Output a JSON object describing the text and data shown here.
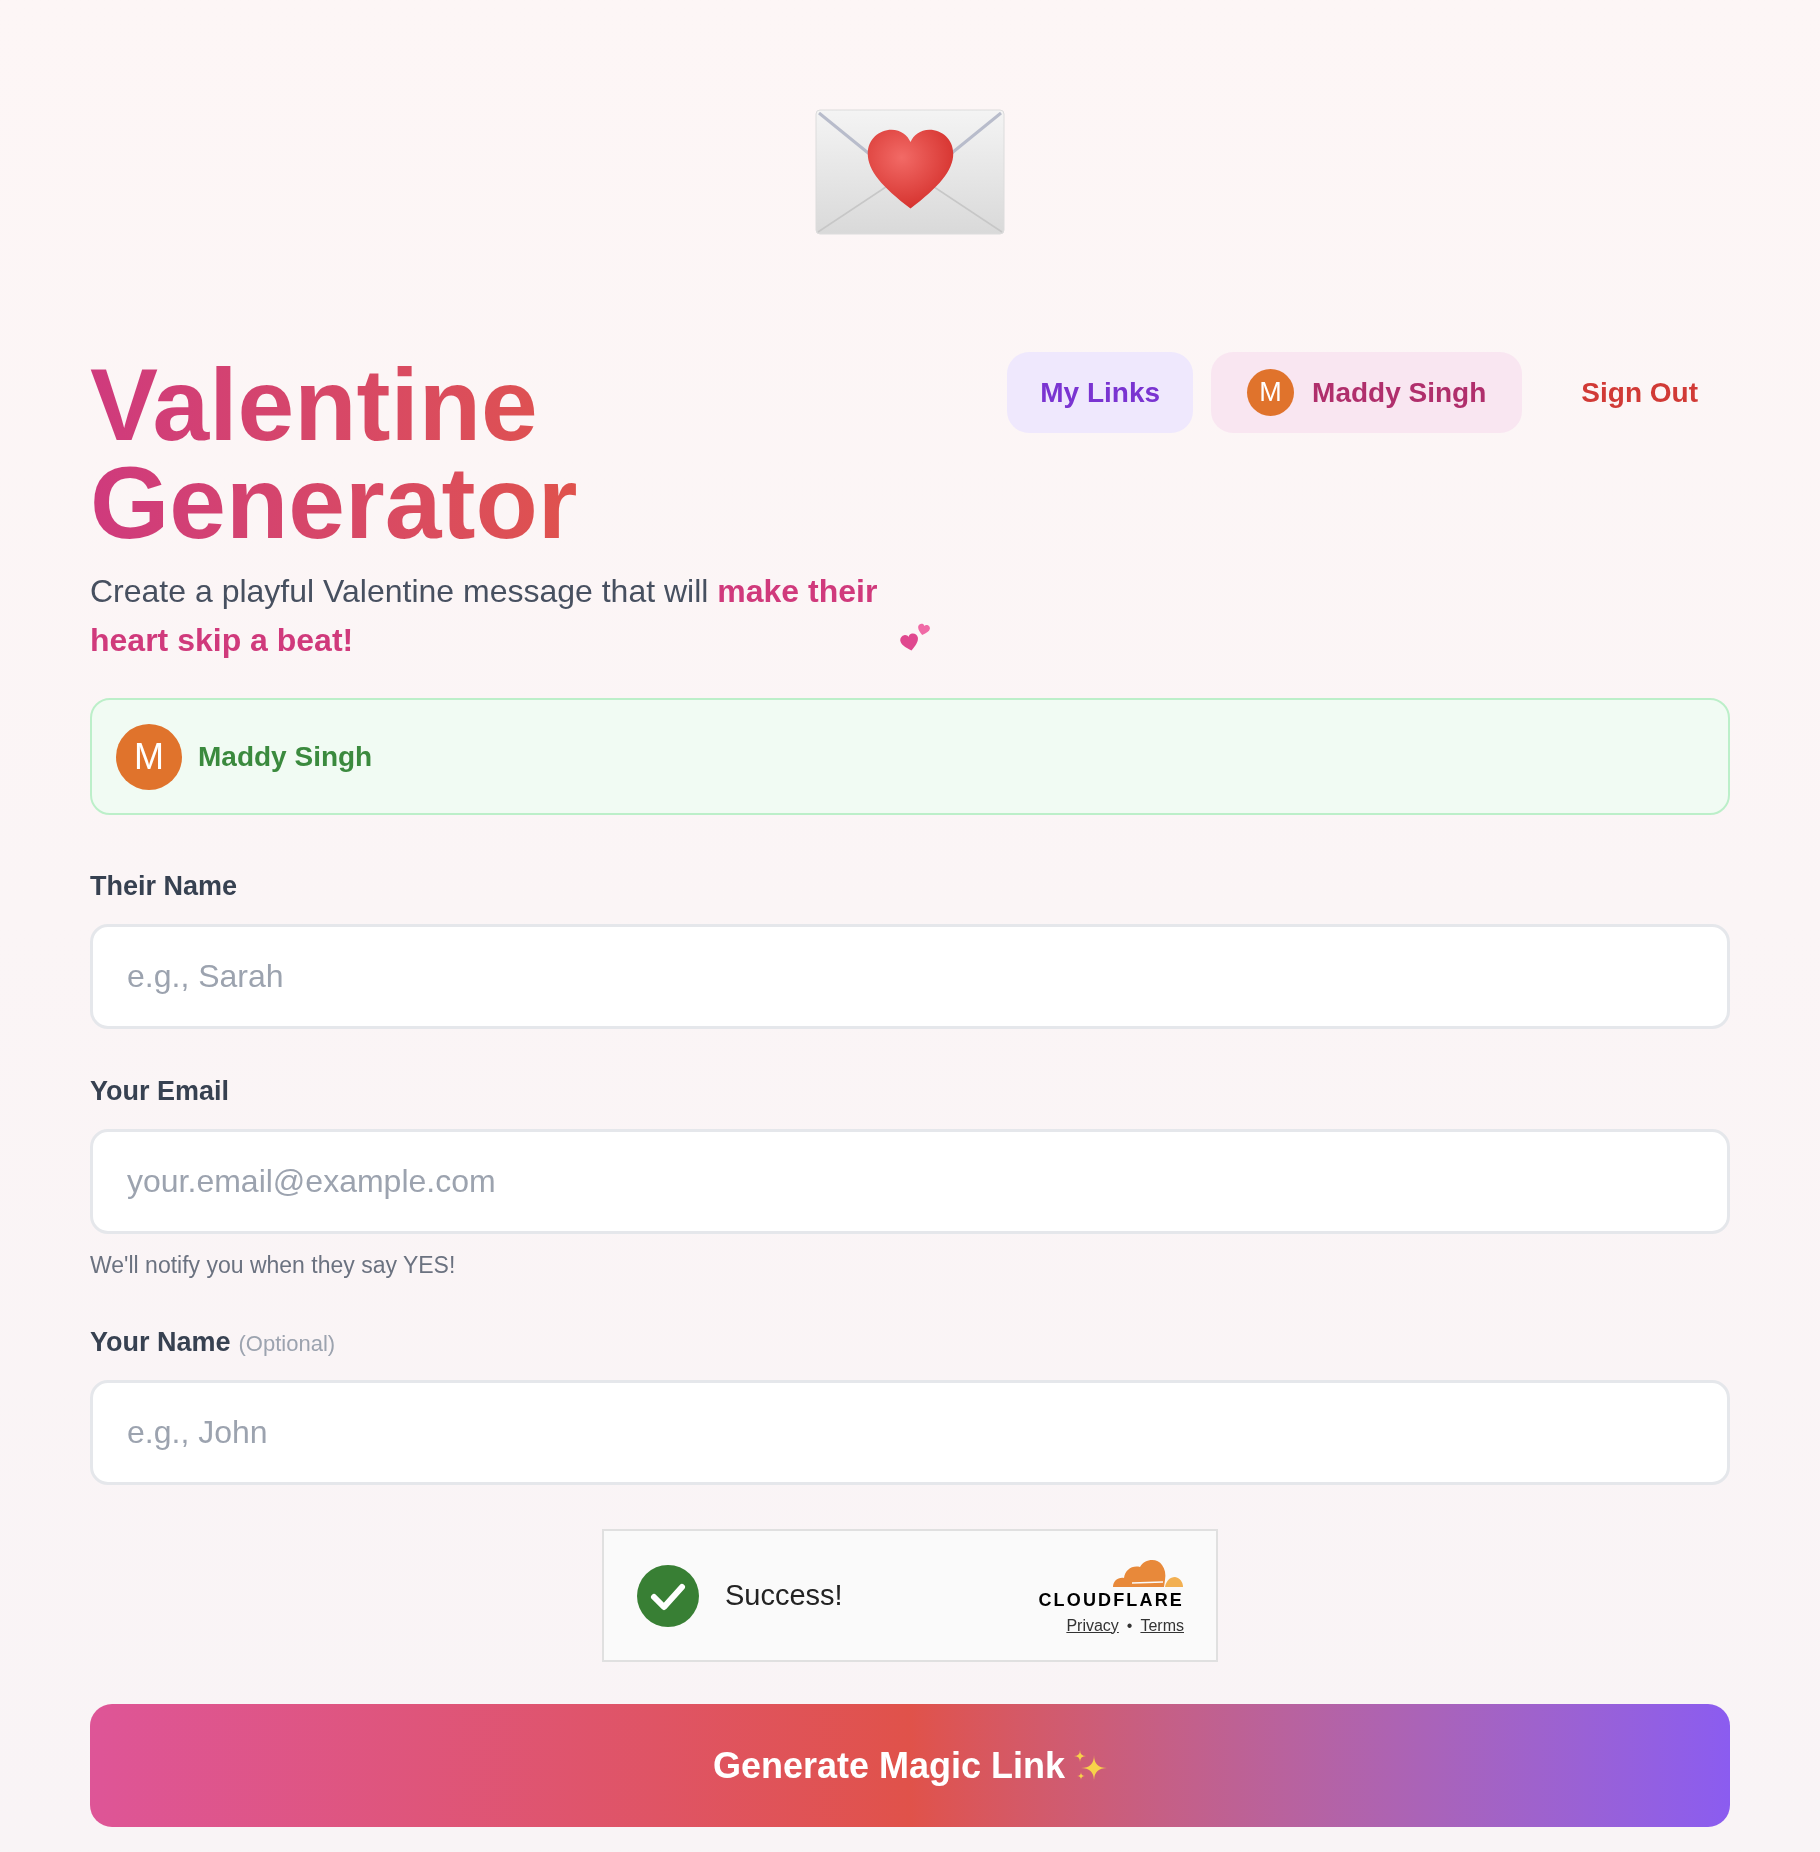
{
  "title": "Valentine Generator",
  "subtitle": "Create a playful Valentine message that will **make their heart skip a beat!**",
  "nav": [
    {
      "kind": "links",
      "label": "My Links"
    },
    {
      "kind": "profile",
      "initial": "M",
      "label": "Maddy Singh"
    },
    {
      "kind": "signout",
      "label": "Sign Out"
    }
  ],
  "signed_in_user": {
    "initial": "M",
    "name": "Maddy Singh"
  },
  "fields": [
    {
      "label": "Their Name",
      "placeholder": "e.g., Sarah"
    },
    {
      "label": "Your Email",
      "placeholder": "your.email@example.com",
      "hint": "We'll notify you when they say YES!"
    },
    {
      "label": "Your Name",
      "note": "(Optional)",
      "placeholder": "e.g., John"
    }
  ],
  "captcha": {
    "verified": true,
    "status": "Success!",
    "brand": "CLOUDFLARE",
    "links": [
      "Privacy",
      "Terms"
    ],
    "separator": "•"
  },
  "submit_button": "Generate Magic Link"
}
